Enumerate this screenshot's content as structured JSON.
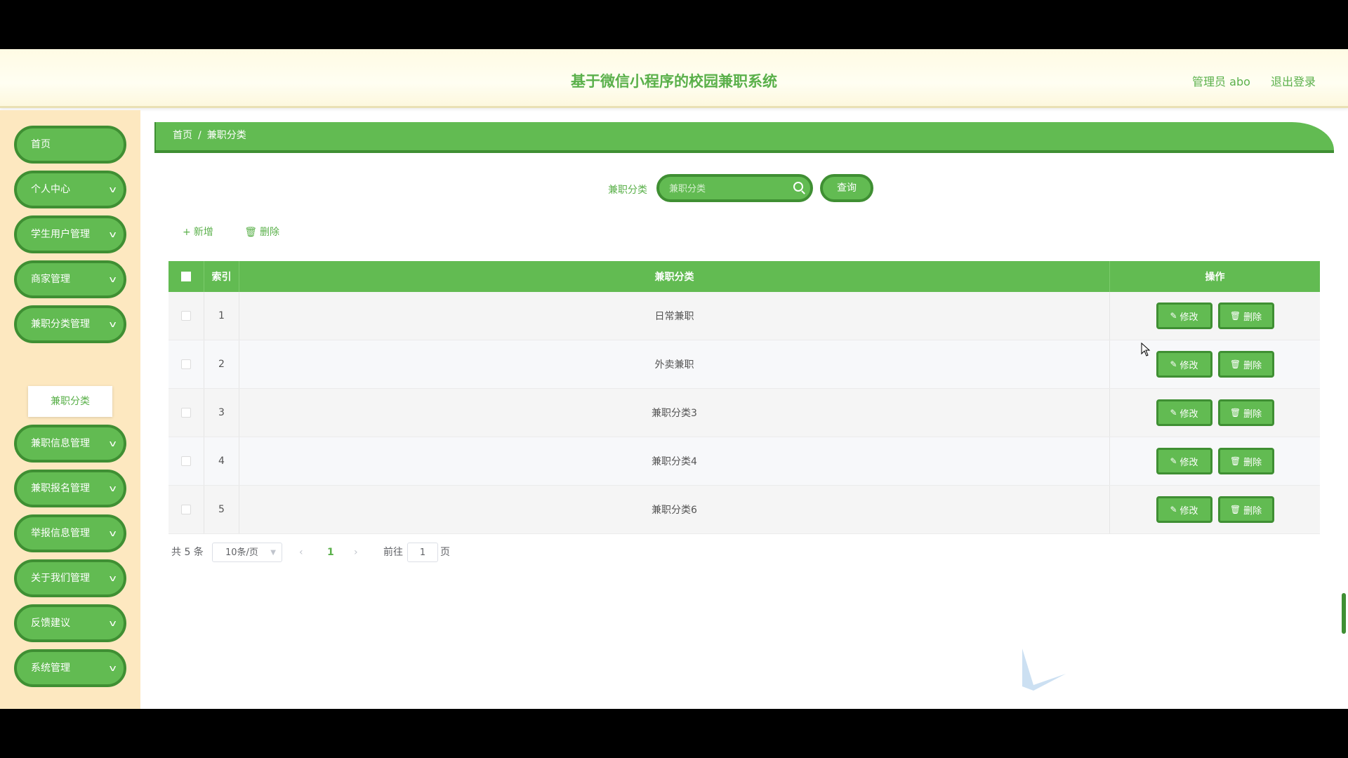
{
  "header": {
    "title": "基于微信小程序的校园兼职系统",
    "user_label": "管理员 abo",
    "logout_label": "退出登录"
  },
  "sidebar": {
    "items": [
      {
        "label": "首页",
        "has_children": false
      },
      {
        "label": "个人中心",
        "has_children": true
      },
      {
        "label": "学生用户管理",
        "has_children": true
      },
      {
        "label": "商家管理",
        "has_children": true
      },
      {
        "label": "兼职分类管理",
        "has_children": true
      },
      {
        "label": "兼职信息管理",
        "has_children": true
      },
      {
        "label": "兼职报名管理",
        "has_children": true
      },
      {
        "label": "举报信息管理",
        "has_children": true
      },
      {
        "label": "关于我们管理",
        "has_children": true
      },
      {
        "label": "反馈建议",
        "has_children": true
      },
      {
        "label": "系统管理",
        "has_children": true
      }
    ],
    "submenu_label": "兼职分类"
  },
  "breadcrumb": {
    "home": "首页",
    "separator": "/",
    "current": "兼职分类"
  },
  "search": {
    "label": "兼职分类",
    "placeholder": "兼职分类",
    "button_label": "查询"
  },
  "actions": {
    "add_label": "新增",
    "delete_label": "删除"
  },
  "table": {
    "columns": [
      "索引",
      "兼职分类",
      "操作"
    ],
    "rows": [
      {
        "index": "1",
        "name": "日常兼职"
      },
      {
        "index": "2",
        "name": "外卖兼职"
      },
      {
        "index": "3",
        "name": "兼职分类3"
      },
      {
        "index": "4",
        "name": "兼职分类4"
      },
      {
        "index": "5",
        "name": "兼职分类6"
      }
    ],
    "edit_label": "修改",
    "delete_label": "删除"
  },
  "pagination": {
    "total_label": "共 5 条",
    "page_size_label": "10条/页",
    "current_page": "1",
    "goto_label": "前往",
    "goto_value": "1",
    "goto_unit": "页"
  },
  "colors": {
    "primary": "#62bb52",
    "primary_dark": "#3f8f33",
    "sidebar_bg": "#fde8c0",
    "header_bg": "#fffbe4"
  }
}
